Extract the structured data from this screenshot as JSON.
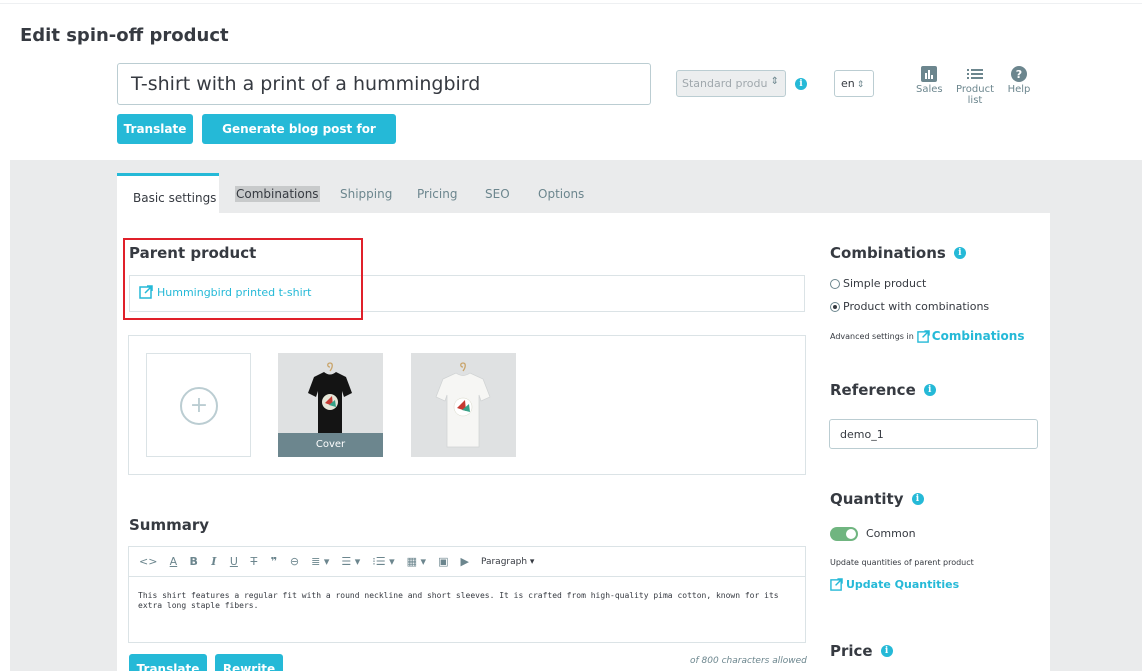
{
  "page": {
    "title": "Edit spin-off product"
  },
  "product": {
    "name": "T-shirt with a print of a hummingbird",
    "type_select": "Standard produ",
    "language": "en"
  },
  "toolbar": {
    "sales_label": "Sales",
    "product_list_label": "Product list",
    "help_label": "Help"
  },
  "actions": {
    "translate_label": "Translate",
    "blog_label": "Generate blog post for product"
  },
  "tabs": [
    {
      "label": "Basic settings",
      "active": true
    },
    {
      "label": "Combinations"
    },
    {
      "label": "Shipping"
    },
    {
      "label": "Pricing"
    },
    {
      "label": "SEO"
    },
    {
      "label": "Options"
    }
  ],
  "parent_product": {
    "heading": "Parent product",
    "link_label": "Hummingbird printed t-shirt"
  },
  "images": {
    "cover_label": "Cover"
  },
  "summary": {
    "heading": "Summary",
    "paragraph_select": "Paragraph",
    "text": "This shirt features a regular fit with a round neckline and short sleeves. It is crafted from high-quality pima cotton, known for its extra long staple fibers.",
    "translate_label": "Translate",
    "rewrite_label": "Rewrite",
    "char_count": "of 800 characters allowed"
  },
  "combinations": {
    "heading": "Combinations",
    "options": [
      "Simple product",
      "Product with combinations"
    ],
    "selected_index": 1,
    "advanced_prefix": "Advanced settings in",
    "advanced_link": "Combinations"
  },
  "reference": {
    "heading": "Reference",
    "value": "demo_1"
  },
  "quantity": {
    "heading": "Quantity",
    "toggle_label": "Common",
    "toggle_on": true,
    "note": "Update quantities of parent product",
    "link_label": "Update Quantities"
  },
  "price": {
    "heading": "Price"
  },
  "colors": {
    "accent": "#25b9d7",
    "toggle_on": "#70b580",
    "highlight_frame": "#e0202a",
    "background_gray": "#eaebec"
  }
}
